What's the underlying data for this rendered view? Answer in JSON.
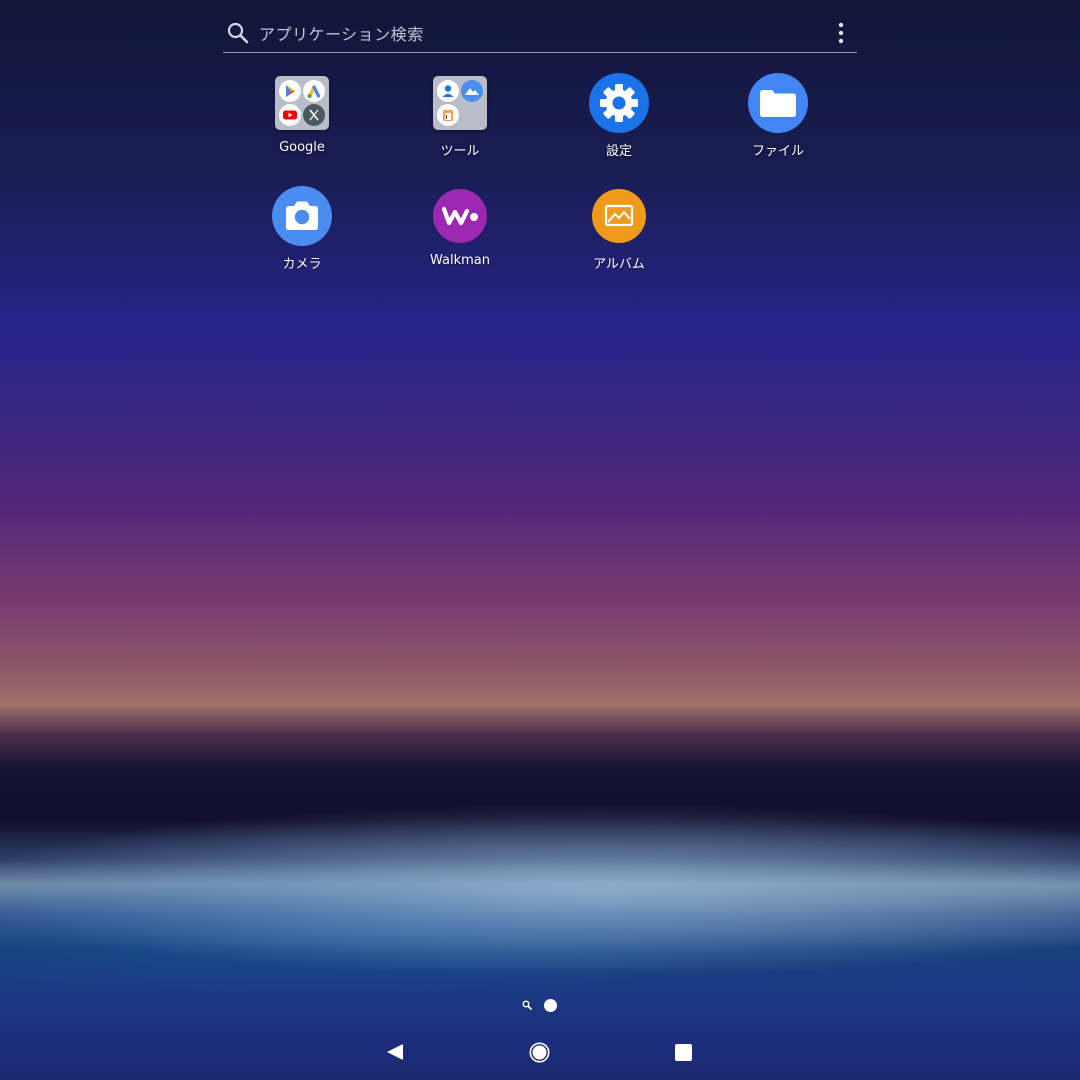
{
  "search": {
    "placeholder": "アプリケーション検索"
  },
  "apps": [
    {
      "label": "Google",
      "icon": "google-folder-icon",
      "type": "folder"
    },
    {
      "label": "ツール",
      "icon": "tools-folder-icon",
      "type": "folder"
    },
    {
      "label": "設定",
      "icon": "settings-gear-icon",
      "type": "app"
    },
    {
      "label": "ファイル",
      "icon": "files-folder-icon",
      "type": "app"
    },
    {
      "label": "カメラ",
      "icon": "camera-icon",
      "type": "app"
    },
    {
      "label": "Walkman",
      "icon": "walkman-icon",
      "type": "app"
    },
    {
      "label": "アルバム",
      "icon": "album-icon",
      "type": "app"
    }
  ],
  "pager": {
    "pages": 1,
    "current": 1
  },
  "navbar": {
    "buttons": [
      "back",
      "home",
      "recents"
    ]
  },
  "colors": {
    "settings": "#1a73e8",
    "files": "#4285f4",
    "camera": "#4a8df0",
    "walkman": "#9c27b0",
    "album": "#ef9a1a",
    "folder": "#b9bcc9"
  }
}
